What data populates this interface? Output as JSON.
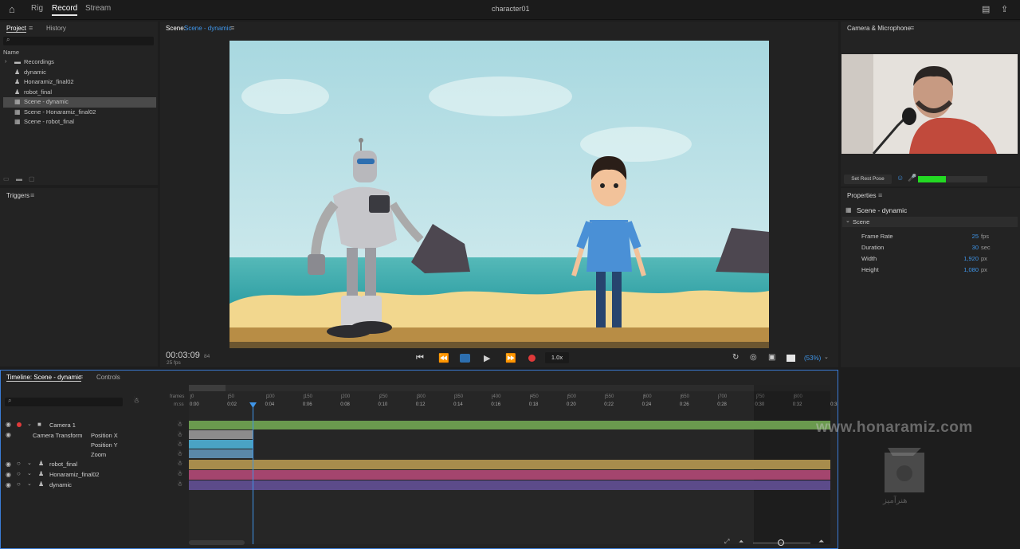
{
  "topbar": {
    "tabs": [
      "Rig",
      "Record",
      "Stream"
    ],
    "active": "Record",
    "title": "character01"
  },
  "project": {
    "tabs": [
      "Project",
      "History"
    ],
    "name_header": "Name",
    "items": [
      {
        "label": "Recordings",
        "type": "folder"
      },
      {
        "label": "dynamic",
        "type": "puppet"
      },
      {
        "label": "Honaramiz_final02",
        "type": "puppet"
      },
      {
        "label": "robot_final",
        "type": "puppet"
      },
      {
        "label": "Scene - dynamic",
        "type": "scene"
      },
      {
        "label": "Scene - Honaramiz_final02",
        "type": "scene"
      },
      {
        "label": "Scene - robot_final",
        "type": "scene"
      }
    ]
  },
  "triggers": {
    "title": "Triggers"
  },
  "scene": {
    "label": "Scene:",
    "name": "Scene - dynamic",
    "timecode": "00:03:09",
    "frame": "84",
    "fps": "25 fps",
    "speed": "1.0x",
    "zoom": "(53%)"
  },
  "camera": {
    "title": "Camera & Microphone",
    "rest_pose": "Set Rest Pose",
    "mic_level": 0.4
  },
  "properties": {
    "title": "Properties",
    "scene_name": "Scene - dynamic",
    "section": "Scene",
    "rows": [
      {
        "label": "Frame Rate",
        "value": "25",
        "unit": "fps"
      },
      {
        "label": "Duration",
        "value": "30",
        "unit": "sec"
      },
      {
        "label": "Width",
        "value": "1,920",
        "unit": "px"
      },
      {
        "label": "Height",
        "value": "1,080",
        "unit": "px"
      }
    ]
  },
  "timeline": {
    "tabs": [
      "Timeline: Scene - dynamic",
      "Controls"
    ],
    "frames_label": "frames",
    "mss_label": "m:ss",
    "frame_ticks": [
      "0",
      "50",
      "100",
      "150",
      "200",
      "250",
      "300",
      "350",
      "400",
      "450",
      "500",
      "550",
      "600",
      "650",
      "700",
      "750",
      "800"
    ],
    "time_ticks": [
      "0:00",
      "0:02",
      "0:04",
      "0:06",
      "0:08",
      "0:10",
      "0:12",
      "0:14",
      "0:16",
      "0:18",
      "0:20",
      "0:22",
      "0:24",
      "0:26",
      "0:28",
      "0:30",
      "0:32",
      "0:3"
    ],
    "tracks": {
      "camera": "Camera 1",
      "transform": "Camera Transform",
      "pos_x": "Position X",
      "pos_y": "Position Y",
      "zoom": "Zoom",
      "robot": "robot_final",
      "honaramiz": "Honaramiz_final02",
      "dynamic": "dynamic"
    }
  },
  "watermark": {
    "text": "www.honaramiz.com",
    "logo_text": "هنرآمیز"
  },
  "colors": {
    "accent": "#3f95e8",
    "camera_track": "#6a9a4e",
    "robot_track": "#a78c4c",
    "honaramiz_track": "#a4456e",
    "dynamic_track": "#5c4b8a",
    "keyframe": "#4aa3c4"
  }
}
